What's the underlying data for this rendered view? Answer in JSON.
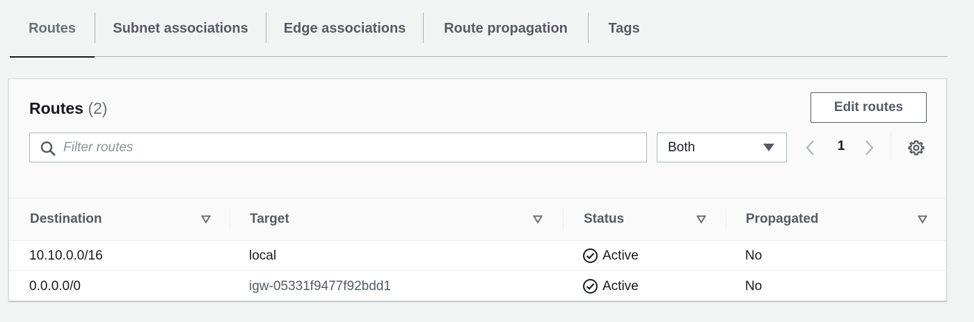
{
  "tabs": [
    {
      "label": "Routes",
      "active": true
    },
    {
      "label": "Subnet associations",
      "active": false
    },
    {
      "label": "Edge associations",
      "active": false
    },
    {
      "label": "Route propagation",
      "active": false
    },
    {
      "label": "Tags",
      "active": false
    }
  ],
  "panel": {
    "title": "Routes",
    "count": "(2)",
    "edit_button": "Edit routes",
    "filter_placeholder": "Filter routes",
    "select_value": "Both",
    "page": "1"
  },
  "table": {
    "columns": [
      "Destination",
      "Target",
      "Status",
      "Propagated"
    ],
    "rows": [
      {
        "destination": "10.10.0.0/16",
        "target": "local",
        "status": "Active",
        "propagated": "No"
      },
      {
        "destination": "0.0.0.0/0",
        "target": "igw-05331f9477f92bdd1",
        "status": "Active",
        "propagated": "No"
      }
    ]
  },
  "icons": {
    "search": "search-icon",
    "dropdown": "caret-down-icon",
    "prev": "chevron-left-icon",
    "next": "chevron-right-icon",
    "settings": "gear-icon",
    "sort": "sort-caret-icon",
    "status": "check-circle-icon"
  },
  "colors": {
    "page_bg": "#f2f3f3",
    "text": "#16191f",
    "secondary_text": "#545b64"
  }
}
